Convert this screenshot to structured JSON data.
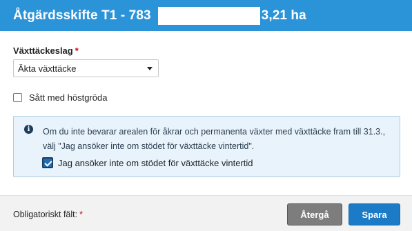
{
  "header": {
    "title_prefix": "Åtgärdsskifte T1 - 783",
    "area": "3,21 ha"
  },
  "form": {
    "cover_type_label": "Växttäckeslag",
    "required_mark": "*",
    "cover_type_value": "Äkta växttäcke",
    "sown_checkbox_label": "Sått med höstgröda",
    "sown_checked": false
  },
  "info": {
    "icon": "info-icon",
    "text": "Om du inte bevarar arealen för åkrar och permanenta växter med växttäcke fram till 31.3., välj \"Jag ansöker inte om stödet för växttäcke vintertid\".",
    "checkbox_label": "Jag ansöker inte om stödet för växttäcke vintertid",
    "checked": true
  },
  "footer": {
    "required_note": "Obligatoriskt fält:",
    "required_mark": "*",
    "back_label": "Återgå",
    "save_label": "Spara"
  },
  "colors": {
    "header_bg": "#2b93d8",
    "primary_button": "#1b7bc6",
    "secondary_button": "#7d7d7d",
    "info_bg": "#e8f3fb",
    "required": "#d0021b"
  }
}
